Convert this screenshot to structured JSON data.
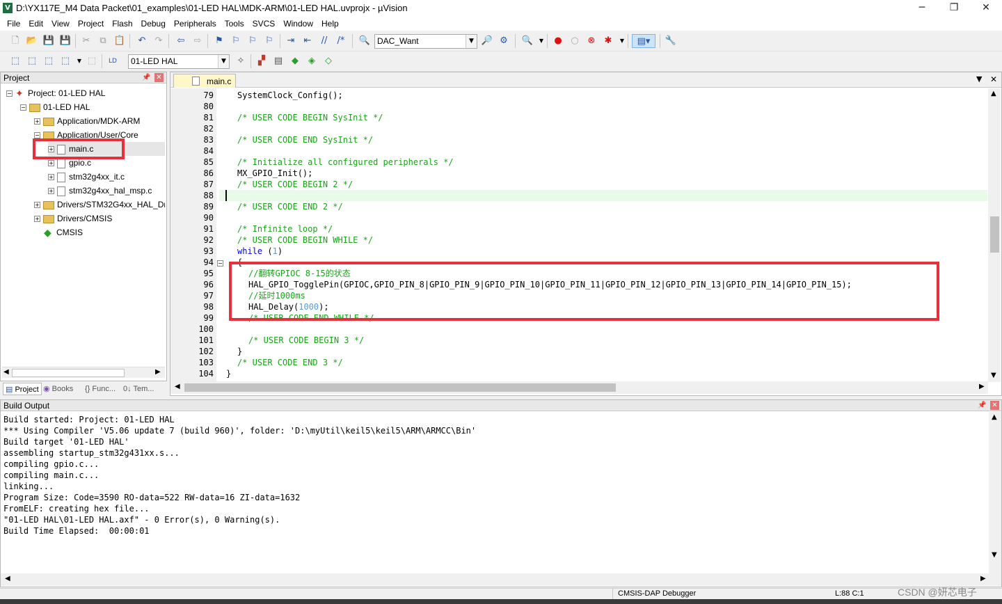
{
  "window": {
    "title": "D:\\YX117E_M4 Data Packet\\01_examples\\01-LED HAL\\MDK-ARM\\01-LED HAL.uvprojx - µVision",
    "minimize": "─",
    "maximize": "❐",
    "close": "✕"
  },
  "menu": [
    "File",
    "Edit",
    "View",
    "Project",
    "Flash",
    "Debug",
    "Peripherals",
    "Tools",
    "SVCS",
    "Window",
    "Help"
  ],
  "toolbar1": {
    "search_combo": "DAC_Want"
  },
  "toolbar2": {
    "target_combo": "01-LED HAL"
  },
  "project_panel": {
    "title": "Project",
    "tree": [
      {
        "label": "Project: 01-LED HAL"
      },
      {
        "label": "01-LED HAL"
      },
      {
        "label": "Application/MDK-ARM"
      },
      {
        "label": "Application/User/Core"
      },
      {
        "label": "main.c"
      },
      {
        "label": "gpio.c"
      },
      {
        "label": "stm32g4xx_it.c"
      },
      {
        "label": "stm32g4xx_hal_msp.c"
      },
      {
        "label": "Drivers/STM32G4xx_HAL_Dri"
      },
      {
        "label": "Drivers/CMSIS"
      },
      {
        "label": "CMSIS"
      }
    ],
    "tabs": [
      "Project",
      "Books",
      "{} Func...",
      "0↓ Tem..."
    ]
  },
  "editor": {
    "active_tab": "main.c",
    "line_numbers": [
      "79",
      "80",
      "81",
      "82",
      "83",
      "84",
      "85",
      "86",
      "87",
      "88",
      "89",
      "90",
      "91",
      "92",
      "93",
      "94",
      "95",
      "96",
      "97",
      "98",
      "99",
      "100",
      "101",
      "102",
      "103",
      "104"
    ],
    "code": {
      "l79": "SystemClock_Config();",
      "l81": "/* USER CODE BEGIN SysInit */",
      "l83": "/* USER CODE END SysInit */",
      "l85": "/* Initialize all configured peripherals */",
      "l86": "MX_GPIO_Init();",
      "l87": "/* USER CODE BEGIN 2 */",
      "l89": "/* USER CODE END 2 */",
      "l91": "/* Infinite loop */",
      "l92": "/* USER CODE BEGIN WHILE */",
      "l93_kw": "while",
      "l93_paren_open": " (",
      "l93_num": "1",
      "l93_paren_close": ")",
      "l94": "{",
      "l95": "//翻转GPIOC 8-15的状态",
      "l96": "HAL_GPIO_TogglePin(GPIOC,GPIO_PIN_8|GPIO_PIN_9|GPIO_PIN_10|GPIO_PIN_11|GPIO_PIN_12|GPIO_PIN_13|GPIO_PIN_14|GPIO_PIN_15);",
      "l97": "//延时1000ms",
      "l98_fn": "HAL_Delay(",
      "l98_num": "1000",
      "l98_end": ");",
      "l99": "/* USER CODE END WHILE */",
      "l101": "/* USER CODE BEGIN 3 */",
      "l102": "}",
      "l103": "/* USER CODE END 3 */",
      "l104": "}"
    }
  },
  "build_output": {
    "title": "Build Output",
    "lines": [
      "Build started: Project: 01-LED HAL",
      "*** Using Compiler 'V5.06 update 7 (build 960)', folder: 'D:\\myUtil\\keil5\\keil5\\ARM\\ARMCC\\Bin'",
      "Build target '01-LED HAL'",
      "assembling startup_stm32g431xx.s...",
      "compiling gpio.c...",
      "compiling main.c...",
      "linking...",
      "Program Size: Code=3590 RO-data=522 RW-data=16 ZI-data=1632",
      "FromELF: creating hex file...",
      "\"01-LED HAL\\01-LED HAL.axf\" - 0 Error(s), 0 Warning(s).",
      "Build Time Elapsed:  00:00:01"
    ]
  },
  "status": {
    "debugger": "CMSIS-DAP Debugger",
    "position": "L:88 C:1",
    "watermark": "CSDN @妍芯电子"
  },
  "colors": {
    "highlight_box": "#e8303a",
    "comment": "#1aa21a",
    "keyword": "#0000ff",
    "number": "#5a9bd5"
  }
}
